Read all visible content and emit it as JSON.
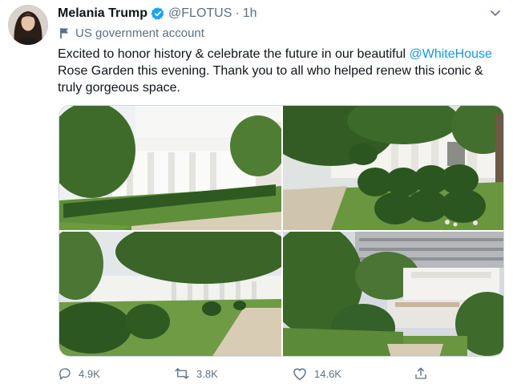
{
  "tweet": {
    "author_name": "Melania Trump",
    "handle": "@FLOTUS",
    "separator": "·",
    "time": "1h",
    "account_label": "US government account",
    "text_before": "Excited to honor history & celebrate the future in our beautiful ",
    "mention": "@WhiteHouse",
    "text_after": " Rose Garden this evening. Thank you to all who helped renew this iconic & truly gorgeous space.",
    "photos": [
      {
        "icon": "rose-garden-colonnade-photo"
      },
      {
        "icon": "rose-garden-hedges-photo"
      },
      {
        "icon": "rose-garden-path-photo"
      },
      {
        "icon": "rose-garden-aerial-photo"
      }
    ]
  },
  "actions": {
    "reply_count": "4.9K",
    "retweet_count": "3.8K",
    "like_count": "14.6K"
  },
  "colors": {
    "link": "#1b95e0",
    "muted": "#5b7083",
    "verified": "#1da1f2"
  },
  "icons": {
    "verified": "verified-badge-icon",
    "more": "more-icon",
    "flag": "flag-icon",
    "reply": "reply-icon",
    "retweet": "retweet-icon",
    "like": "heart-icon",
    "share": "share-icon"
  }
}
